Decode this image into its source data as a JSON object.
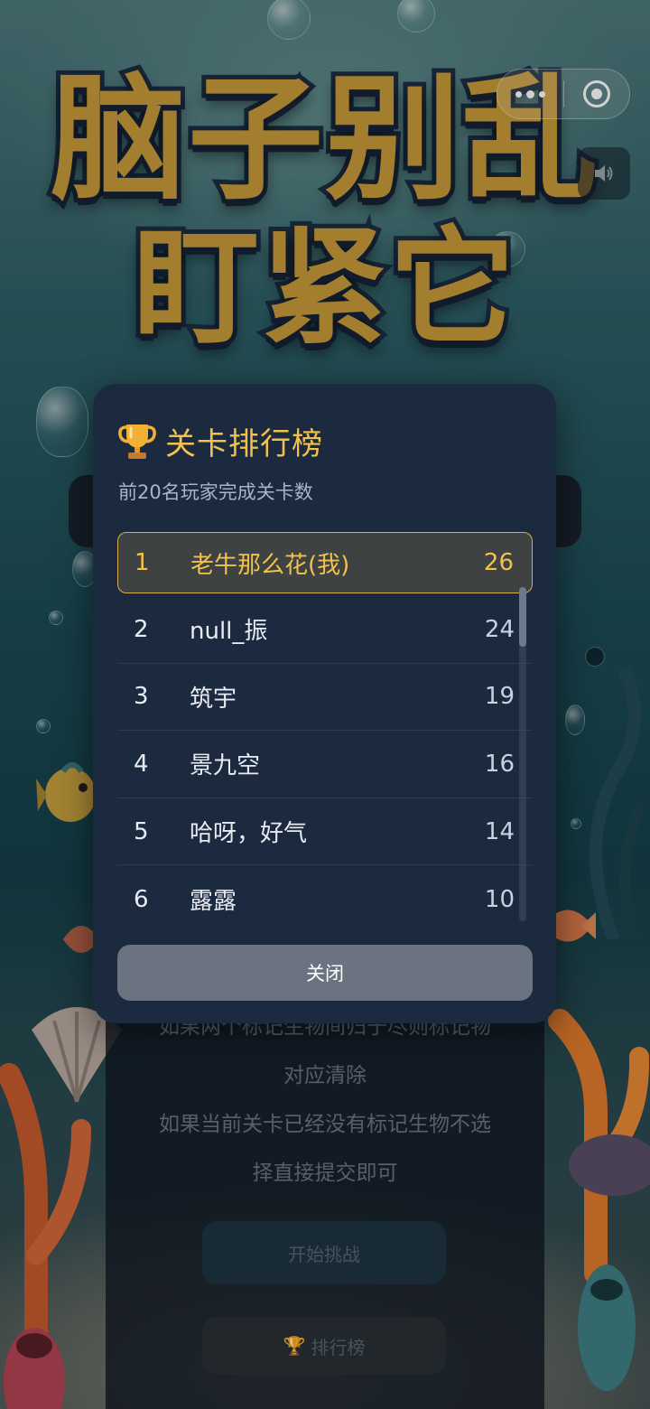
{
  "game": {
    "title_line1": "脑子别乱",
    "title_line2": "盯紧它"
  },
  "background_page": {
    "rules_lines": [
      "如果两个标记生物间归于尽则标记物",
      "对应清除",
      "如果当前关卡已经没有标记生物不选",
      "择直接提交即可"
    ],
    "start_button": "开始挑战",
    "rank_button": "排行榜",
    "rank_button_icon": "trophy-icon"
  },
  "leaderboard": {
    "title": "关卡排行榜",
    "title_icon": "trophy-icon",
    "subtitle": "前20名玩家完成关卡数",
    "rows": [
      {
        "rank": "1",
        "name": "老牛那么花(我)",
        "score": "26",
        "is_me": true
      },
      {
        "rank": "2",
        "name": "null_振",
        "score": "24",
        "is_me": false
      },
      {
        "rank": "3",
        "name": "筑宇",
        "score": "19",
        "is_me": false
      },
      {
        "rank": "4",
        "name": "景九空",
        "score": "16",
        "is_me": false
      },
      {
        "rank": "5",
        "name": "哈呀，好气",
        "score": "14",
        "is_me": false
      },
      {
        "rank": "6",
        "name": "露露",
        "score": "10",
        "is_me": false
      }
    ],
    "close_label": "关闭"
  },
  "colors": {
    "accent_gold": "#f2c14e",
    "modal_bg": "#1c2a40",
    "close_button_bg": "#6b7380"
  },
  "icons": {
    "more": "more-dots-icon",
    "close_miniprogram": "target-close-icon",
    "sound": "speaker-icon"
  }
}
